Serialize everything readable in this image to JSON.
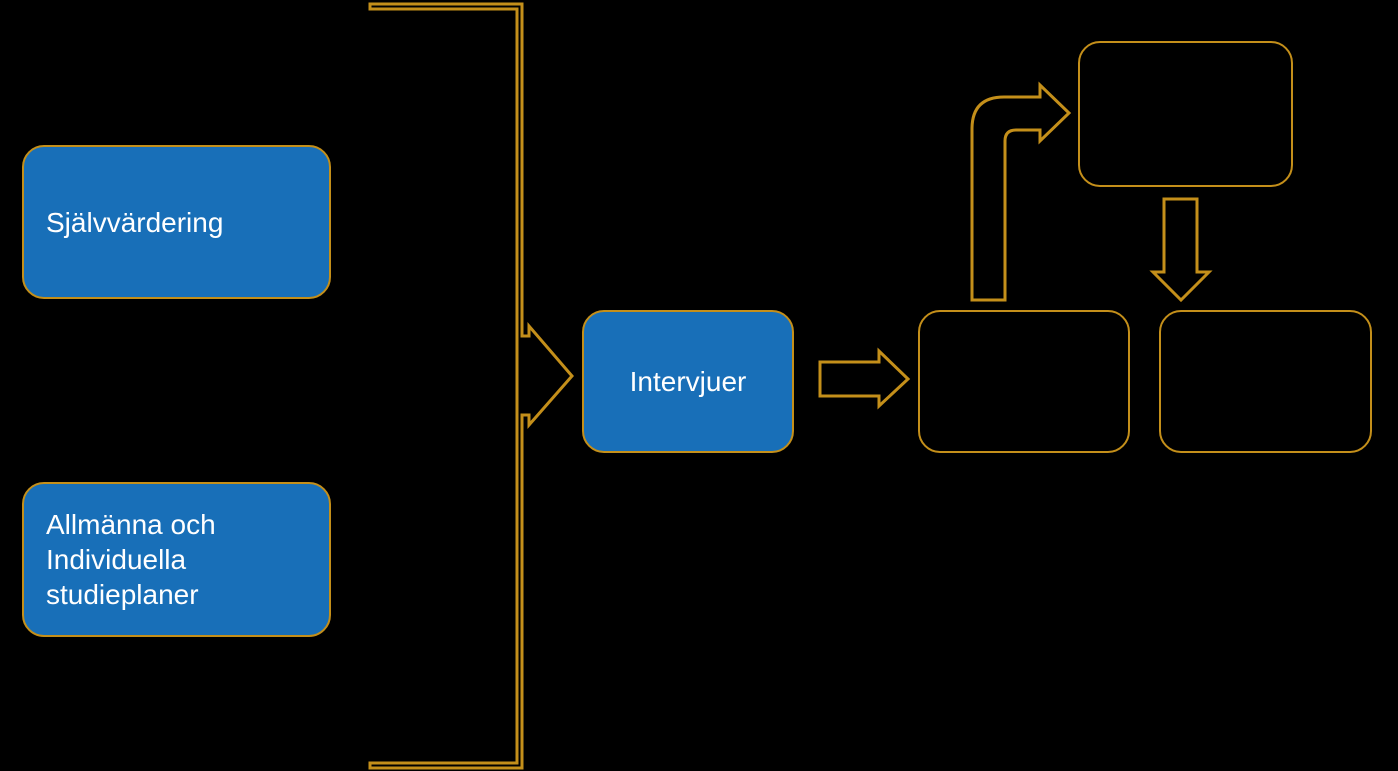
{
  "colors": {
    "bg": "#000000",
    "blue": "#186FB8",
    "gold": "#C48F1A",
    "text": "#FFFFFF"
  },
  "nodes": {
    "box1": {
      "label": "Självvärdering"
    },
    "box2a": {
      "label": "Allmänna och"
    },
    "box2b": {
      "label": "Individuella"
    },
    "box2c": {
      "label": "studieplaner"
    },
    "box3": {
      "label": "Intervjuer"
    },
    "box4": {
      "label": ""
    },
    "box5": {
      "label": ""
    },
    "box6": {
      "label": ""
    }
  }
}
